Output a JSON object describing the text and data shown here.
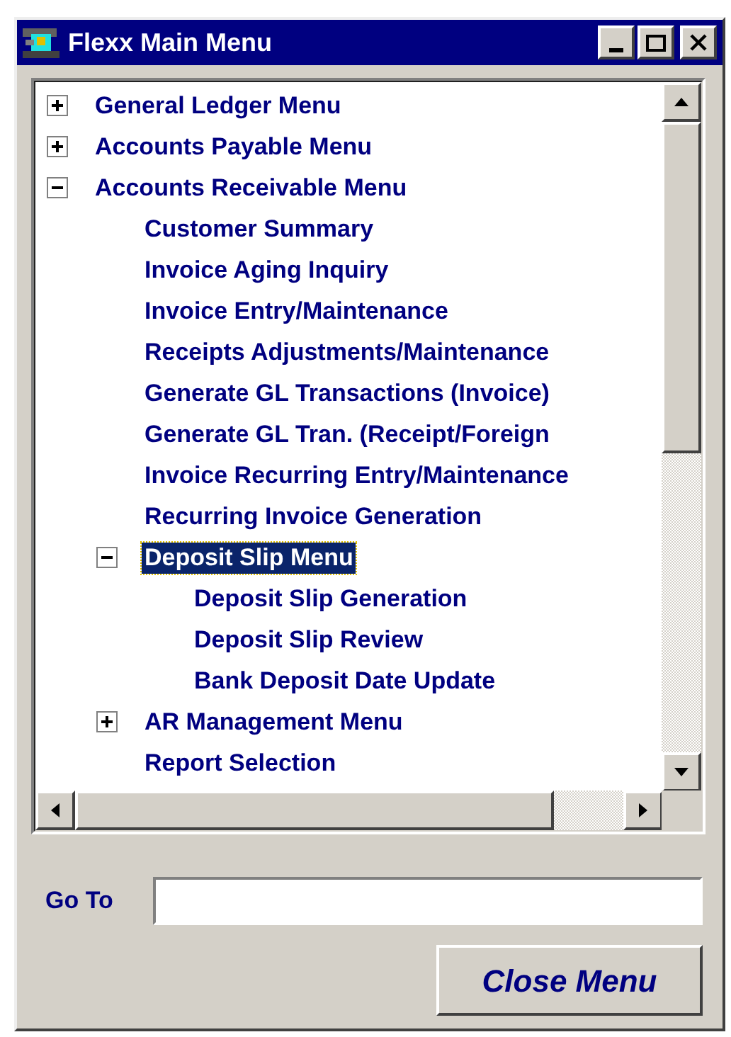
{
  "window": {
    "title": "Flexx Main Menu"
  },
  "tree": {
    "items": [
      {
        "label": "General Ledger Menu",
        "expanded": false,
        "selected": false
      },
      {
        "label": "Accounts Payable Menu",
        "expanded": false,
        "selected": false
      },
      {
        "label": "Accounts Receivable Menu",
        "expanded": true,
        "selected": false,
        "children": [
          {
            "label": "Customer Summary",
            "selected": false
          },
          {
            "label": "Invoice Aging Inquiry",
            "selected": false
          },
          {
            "label": "Invoice Entry/Maintenance",
            "selected": false
          },
          {
            "label": "Receipts Adjustments/Maintenance",
            "selected": false
          },
          {
            "label": "Generate GL Transactions (Invoice)",
            "selected": false
          },
          {
            "label": "Generate GL Tran. (Receipt/Foreign",
            "selected": false
          },
          {
            "label": "Invoice Recurring Entry/Maintenance",
            "selected": false
          },
          {
            "label": "Recurring Invoice Generation",
            "selected": false
          },
          {
            "label": "Deposit Slip Menu",
            "expanded": true,
            "selected": true,
            "children": [
              {
                "label": "Deposit Slip Generation",
                "selected": false
              },
              {
                "label": "Deposit Slip Review",
                "selected": false
              },
              {
                "label": "Bank Deposit Date Update",
                "selected": false
              }
            ]
          },
          {
            "label": "AR Management Menu",
            "expanded": false,
            "selected": false
          },
          {
            "label": "Report Selection",
            "selected": false
          }
        ]
      }
    ]
  },
  "goto": {
    "label": "Go To"
  },
  "buttons": [
    {
      "label": "Close Menu"
    }
  ]
}
